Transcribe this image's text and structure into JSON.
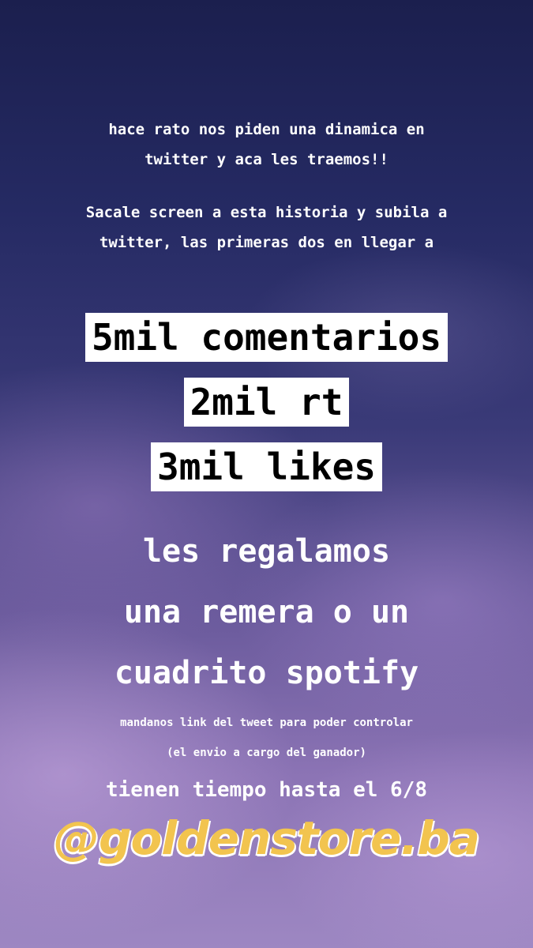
{
  "story": {
    "intro_line1": "hace rato nos piden una dinamica en",
    "intro_line2": "twitter y aca les traemos!!",
    "instr_line1": "Sacale screen a esta historia y subila a",
    "instr_line2": "twitter, las primeras dos en llegar a",
    "goals": [
      "5mil comentarios",
      "2mil rt",
      "3mil likes"
    ],
    "prize_line1": "les regalamos",
    "prize_line2": "una remera o un",
    "prize_line3": "cuadrito spotify",
    "note_line1": "mandanos link del tweet para poder controlar",
    "note_line2": "(el envio a cargo del ganador)",
    "deadline": "tienen tiempo hasta el 6/8",
    "handle": "@goldenstore.ba",
    "handle_color": "#f2c44f"
  }
}
